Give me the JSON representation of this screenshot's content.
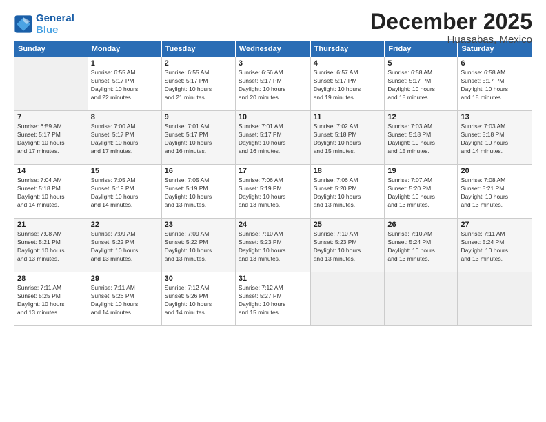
{
  "logo": {
    "line1": "General",
    "line2": "Blue"
  },
  "header": {
    "month": "December 2025",
    "location": "Huasabas, Mexico"
  },
  "weekdays": [
    "Sunday",
    "Monday",
    "Tuesday",
    "Wednesday",
    "Thursday",
    "Friday",
    "Saturday"
  ],
  "weeks": [
    [
      {
        "day": "",
        "empty": true
      },
      {
        "day": "1",
        "sunrise": "6:55 AM",
        "sunset": "5:17 PM",
        "daylight": "10 hours and 22 minutes."
      },
      {
        "day": "2",
        "sunrise": "6:55 AM",
        "sunset": "5:17 PM",
        "daylight": "10 hours and 21 minutes."
      },
      {
        "day": "3",
        "sunrise": "6:56 AM",
        "sunset": "5:17 PM",
        "daylight": "10 hours and 20 minutes."
      },
      {
        "day": "4",
        "sunrise": "6:57 AM",
        "sunset": "5:17 PM",
        "daylight": "10 hours and 19 minutes."
      },
      {
        "day": "5",
        "sunrise": "6:58 AM",
        "sunset": "5:17 PM",
        "daylight": "10 hours and 18 minutes."
      },
      {
        "day": "6",
        "sunrise": "6:58 AM",
        "sunset": "5:17 PM",
        "daylight": "10 hours and 18 minutes."
      }
    ],
    [
      {
        "day": "7",
        "sunrise": "6:59 AM",
        "sunset": "5:17 PM",
        "daylight": "10 hours and 17 minutes."
      },
      {
        "day": "8",
        "sunrise": "7:00 AM",
        "sunset": "5:17 PM",
        "daylight": "10 hours and 17 minutes."
      },
      {
        "day": "9",
        "sunrise": "7:01 AM",
        "sunset": "5:17 PM",
        "daylight": "10 hours and 16 minutes."
      },
      {
        "day": "10",
        "sunrise": "7:01 AM",
        "sunset": "5:17 PM",
        "daylight": "10 hours and 16 minutes."
      },
      {
        "day": "11",
        "sunrise": "7:02 AM",
        "sunset": "5:18 PM",
        "daylight": "10 hours and 15 minutes."
      },
      {
        "day": "12",
        "sunrise": "7:03 AM",
        "sunset": "5:18 PM",
        "daylight": "10 hours and 15 minutes."
      },
      {
        "day": "13",
        "sunrise": "7:03 AM",
        "sunset": "5:18 PM",
        "daylight": "10 hours and 14 minutes."
      }
    ],
    [
      {
        "day": "14",
        "sunrise": "7:04 AM",
        "sunset": "5:18 PM",
        "daylight": "10 hours and 14 minutes."
      },
      {
        "day": "15",
        "sunrise": "7:05 AM",
        "sunset": "5:19 PM",
        "daylight": "10 hours and 14 minutes."
      },
      {
        "day": "16",
        "sunrise": "7:05 AM",
        "sunset": "5:19 PM",
        "daylight": "10 hours and 13 minutes."
      },
      {
        "day": "17",
        "sunrise": "7:06 AM",
        "sunset": "5:19 PM",
        "daylight": "10 hours and 13 minutes."
      },
      {
        "day": "18",
        "sunrise": "7:06 AM",
        "sunset": "5:20 PM",
        "daylight": "10 hours and 13 minutes."
      },
      {
        "day": "19",
        "sunrise": "7:07 AM",
        "sunset": "5:20 PM",
        "daylight": "10 hours and 13 minutes."
      },
      {
        "day": "20",
        "sunrise": "7:08 AM",
        "sunset": "5:21 PM",
        "daylight": "10 hours and 13 minutes."
      }
    ],
    [
      {
        "day": "21",
        "sunrise": "7:08 AM",
        "sunset": "5:21 PM",
        "daylight": "10 hours and 13 minutes."
      },
      {
        "day": "22",
        "sunrise": "7:09 AM",
        "sunset": "5:22 PM",
        "daylight": "10 hours and 13 minutes."
      },
      {
        "day": "23",
        "sunrise": "7:09 AM",
        "sunset": "5:22 PM",
        "daylight": "10 hours and 13 minutes."
      },
      {
        "day": "24",
        "sunrise": "7:10 AM",
        "sunset": "5:23 PM",
        "daylight": "10 hours and 13 minutes."
      },
      {
        "day": "25",
        "sunrise": "7:10 AM",
        "sunset": "5:23 PM",
        "daylight": "10 hours and 13 minutes."
      },
      {
        "day": "26",
        "sunrise": "7:10 AM",
        "sunset": "5:24 PM",
        "daylight": "10 hours and 13 minutes."
      },
      {
        "day": "27",
        "sunrise": "7:11 AM",
        "sunset": "5:24 PM",
        "daylight": "10 hours and 13 minutes."
      }
    ],
    [
      {
        "day": "28",
        "sunrise": "7:11 AM",
        "sunset": "5:25 PM",
        "daylight": "10 hours and 13 minutes."
      },
      {
        "day": "29",
        "sunrise": "7:11 AM",
        "sunset": "5:26 PM",
        "daylight": "10 hours and 14 minutes."
      },
      {
        "day": "30",
        "sunrise": "7:12 AM",
        "sunset": "5:26 PM",
        "daylight": "10 hours and 14 minutes."
      },
      {
        "day": "31",
        "sunrise": "7:12 AM",
        "sunset": "5:27 PM",
        "daylight": "10 hours and 15 minutes."
      },
      {
        "day": "",
        "empty": true
      },
      {
        "day": "",
        "empty": true
      },
      {
        "day": "",
        "empty": true
      }
    ]
  ],
  "labels": {
    "sunrise_prefix": "Sunrise: ",
    "sunset_prefix": "Sunset: ",
    "daylight_prefix": "Daylight: "
  }
}
